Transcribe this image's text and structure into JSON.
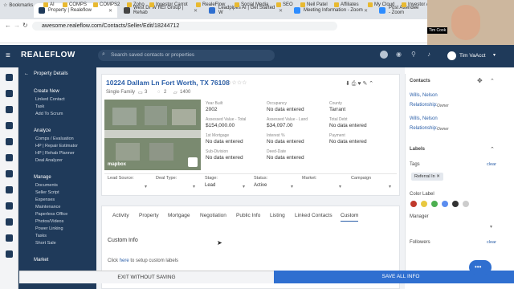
{
  "browser": {
    "tabs": [
      {
        "label": "Property | Realeflow",
        "active": true,
        "color": "#1f3a5a"
      },
      {
        "label": "West DFW REI Group | Rehab",
        "active": false,
        "color": "#444"
      },
      {
        "label": "Leadpipes AI | Get Started W",
        "active": false,
        "color": "#2f6fd0"
      },
      {
        "label": "Meeting Information - Zoom",
        "active": false,
        "color": "#2d8cff"
      },
      {
        "label": "Post Attendee - Zoom",
        "active": false,
        "color": "#2d8cff"
      }
    ],
    "url": "awesome.realeflow.com/Contacts/Seller/Edit/18244712",
    "bookmarks": [
      "Bookmarks",
      "AI",
      "COMPS",
      "COMPS2",
      "Zoho",
      "Investor Carrot",
      "RealeFlow",
      "Social Media",
      "SEO",
      "Neil Patel",
      "Affiliates",
      "My Cloud",
      "Investor Army"
    ],
    "video_name": "Tim Cook"
  },
  "app": {
    "logo": "REALEFLOW",
    "search_placeholder": "Search saved contacts or properties",
    "user_name": "Tim VaAcct"
  },
  "subnav": {
    "items": [
      {
        "label": "Property Details",
        "head": true
      },
      {
        "label": "Create New",
        "head": true
      },
      {
        "label": "Linked Contact",
        "head": false
      },
      {
        "label": "Task",
        "head": false
      },
      {
        "label": "Add To Scrum",
        "head": false
      },
      {
        "label": "Analyze",
        "head": true
      },
      {
        "label": "Comps / Evaluation",
        "head": false
      },
      {
        "label": "HP | Repair Estimator",
        "head": false
      },
      {
        "label": "HP | Rehab Planner",
        "head": false
      },
      {
        "label": "Deal Analyzer",
        "head": false
      },
      {
        "label": "Manage",
        "head": true
      },
      {
        "label": "Documents",
        "head": false
      },
      {
        "label": "Seller Script",
        "head": false
      },
      {
        "label": "Expenses",
        "head": false
      },
      {
        "label": "Maintenance",
        "head": false
      },
      {
        "label": "Paperless Office",
        "head": false
      },
      {
        "label": "Photos/Videos",
        "head": false
      },
      {
        "label": "Power Linking",
        "head": false
      },
      {
        "label": "Tasks",
        "head": false
      },
      {
        "label": "Short Sale",
        "head": false
      },
      {
        "label": "Market",
        "head": true
      }
    ]
  },
  "property": {
    "address": "10224 Dallam Ln Fort Worth, TX 76108",
    "type": "Single Family",
    "beds": "3",
    "baths": "2",
    "sqft": "1400",
    "photo_brand": "mapbox",
    "fields": [
      {
        "label": "Year Built",
        "value": "2002"
      },
      {
        "label": "Occupancy",
        "value": "No data entered"
      },
      {
        "label": "County",
        "value": "Tarrant"
      },
      {
        "label": "Assessed Value - Total",
        "value": "$154,000.00"
      },
      {
        "label": "Assessed Value - Land",
        "value": "$34,097.00"
      },
      {
        "label": "Total Debt",
        "value": "No data entered"
      },
      {
        "label": "1st Mortgage",
        "value": "No data entered"
      },
      {
        "label": "Interest %",
        "value": "No data entered"
      },
      {
        "label": "Payment",
        "value": "No data entered"
      },
      {
        "label": "Sub-Division",
        "value": "No data entered"
      },
      {
        "label": "Deed-Date",
        "value": "No data entered"
      }
    ],
    "dropdowns": [
      {
        "label": "Lead Source:",
        "value": ""
      },
      {
        "label": "Deal Type:",
        "value": ""
      },
      {
        "label": "Stage:",
        "value": "Lead"
      },
      {
        "label": "Status:",
        "value": "Active"
      },
      {
        "label": "Market:",
        "value": ""
      },
      {
        "label": "Campaign",
        "value": ""
      }
    ]
  },
  "detail_tabs": [
    "Activity",
    "Property",
    "Mortgage",
    "Negotiation",
    "Public Info",
    "Listing",
    "Linked Contacts",
    "Custom"
  ],
  "custom_info": {
    "title": "Custom Info",
    "help_prefix": "Click",
    "help_link": "here",
    "help_suffix": "to setup custom labels"
  },
  "right_panel": {
    "contacts_title": "Contacts",
    "contacts": [
      {
        "name": "Wills, Nelson",
        "role": "Relationship:",
        "relation": "Owner"
      },
      {
        "name": "Wills, Nelson",
        "role": "Relationship:",
        "relation": "Owner"
      }
    ],
    "labels_title": "Labels",
    "tags_label": "Tags",
    "clear": "clear",
    "tag": "Referral In",
    "color_label": "Color Label",
    "colors": [
      "#c0392b",
      "#e8c840",
      "#4caf50",
      "#5b8def",
      "#333333",
      "#cccccc"
    ],
    "manager_label": "Manager",
    "followers_label": "Followers"
  },
  "footer": {
    "exit": "EXIT WITHOUT SAVING",
    "save": "SAVE ALL INFO"
  }
}
